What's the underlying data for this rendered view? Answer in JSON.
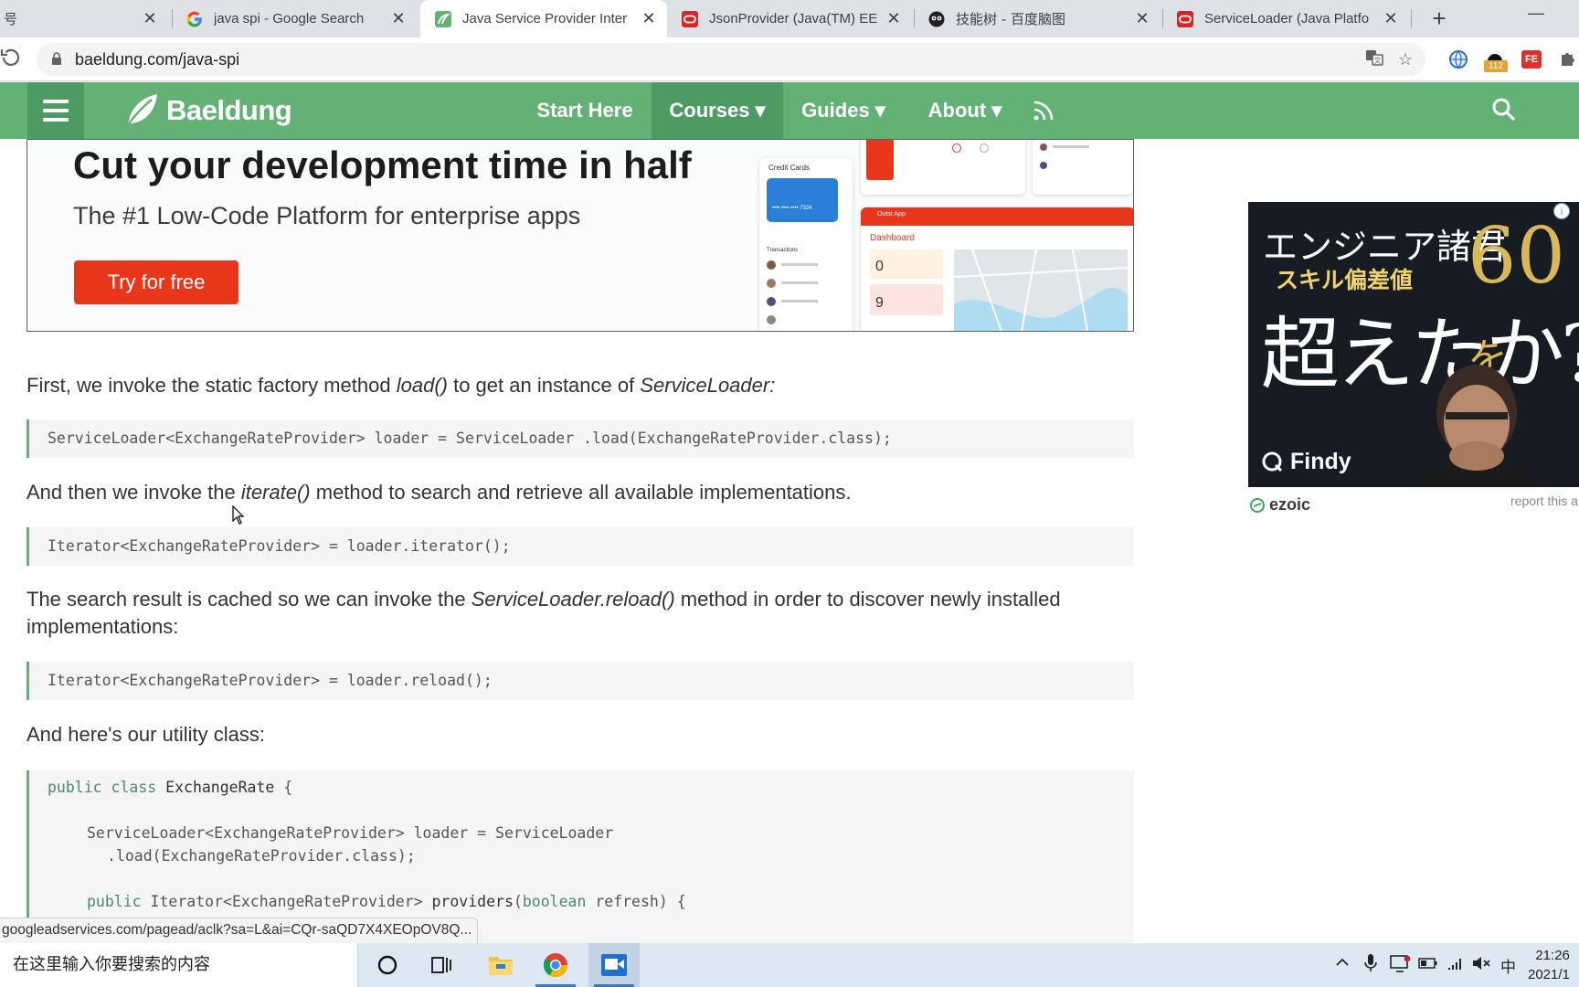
{
  "browser": {
    "tabs": [
      {
        "title": "java spi - Google Search",
        "favicon": "google-icon"
      },
      {
        "title": "Java Service Provider Inter",
        "favicon": "baeldung-icon",
        "active": true
      },
      {
        "title": "JsonProvider (Java(TM) EE",
        "favicon": "oracle-icon"
      },
      {
        "title": "技能树 - 百度脑图",
        "favicon": "baidu-naotu-icon"
      },
      {
        "title": "ServiceLoader (Java Platfo",
        "favicon": "oracle-icon"
      }
    ],
    "partial_tab_text": "号",
    "close_glyph": "✕",
    "newtab_glyph": "+",
    "minimize_glyph": "—",
    "url": "baeldung.com/java-spi",
    "ext_badge": "112",
    "ext_label": "FE"
  },
  "site": {
    "brand": "Baeldung",
    "nav": [
      {
        "label": "Start Here"
      },
      {
        "label": "Courses ▾",
        "active": true
      },
      {
        "label": "Guides ▾"
      },
      {
        "label": "About ▾"
      }
    ],
    "accent_color": "#63b175"
  },
  "banner": {
    "headline": "Cut your development time in half",
    "subline": "The #1 Low-Code Platform for enterprise apps",
    "cta": "Try for free",
    "mock_credit_title": "Credit Cards",
    "mock_dashboard_title": "Dashboard",
    "mock_app_title": "Outst App",
    "mock_value_a": "0",
    "mock_value_b": "9",
    "mock_card_number": "•••• •••• •••• 7324",
    "mock_transactions_title": "Transactions"
  },
  "article": {
    "p1": {
      "a": "First, we invoke the static factory method ",
      "em1": "load()",
      "b": " to get an instance of ",
      "em2": "ServiceLoader:"
    },
    "code1": "ServiceLoader<ExchangeRateProvider> loader = ServiceLoader .load(ExchangeRateProvider.class);",
    "p2": {
      "a": "And then we invoke the ",
      "em1": "iterate()",
      "b": " method to search and retrieve all available implementations."
    },
    "code2": "Iterator<ExchangeRateProvider> = loader.iterator();",
    "p3": {
      "a": "The search result is cached so we can invoke the ",
      "em1": "ServiceLoader.reload()",
      "b": " method in order to discover newly installed",
      "c": "implementations:"
    },
    "code3": "Iterator<ExchangeRateProvider> = loader.reload();",
    "p4": "And here's our utility class:",
    "code4": {
      "l1_kw": "public class ",
      "l1_name": "ExchangeRate",
      "l1_rest": " {",
      "l2": "ServiceLoader<ExchangeRateProvider> loader = ServiceLoader",
      "l3": ".load(ExchangeRateProvider.class);",
      "l4_kw": "public ",
      "l4_type": "Iterator<ExchangeRateProvider> ",
      "l4_name": "providers",
      "l4_p1": "(",
      "l4_kw2": "boolean",
      "l4_p2": " refresh) {"
    }
  },
  "sidead": {
    "line1": "エンジニア諸君",
    "line2": "スキル偏差値",
    "line3": "超えたか?",
    "number": "60",
    "suffix": "を",
    "brand": "Findy",
    "info": "i"
  },
  "ezoic": {
    "label": "ezoic",
    "report": "report this a"
  },
  "status_url": "googleadservices.com/pagead/aclk?sa=L&ai=CQr-saQD7X4XEOpOV8Q...",
  "taskbar": {
    "search_placeholder": "在这里输入你要搜索的内容",
    "time": "21:26",
    "date": "2021/1",
    "ime": "中"
  }
}
